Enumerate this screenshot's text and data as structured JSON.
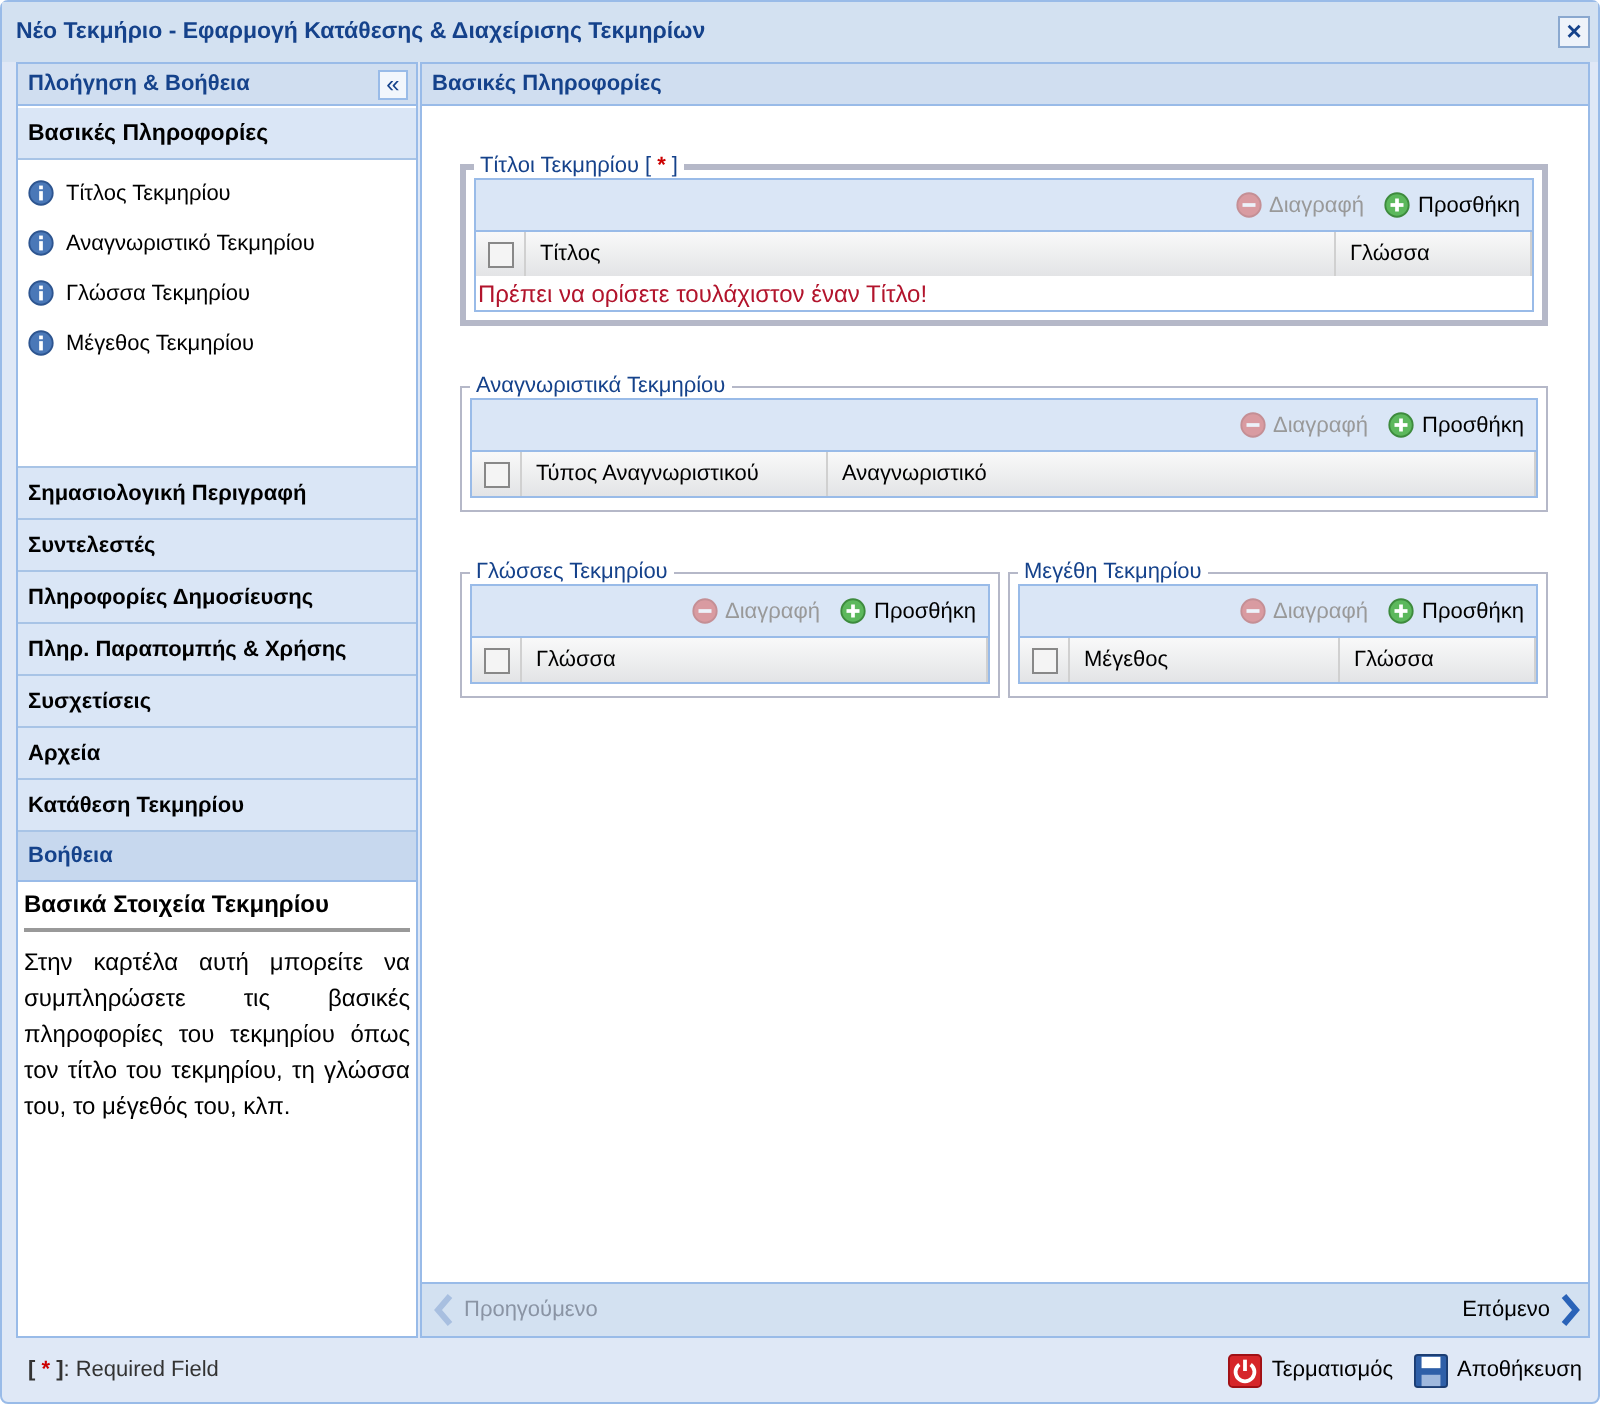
{
  "window": {
    "title": "Νέο Τεκμήριο - Εφαρμογή Κατάθεσης & Διαχείρισης Τεκμηρίων",
    "close": "×"
  },
  "sidebar": {
    "title": "Πλοήγηση & Βοήθεια",
    "collapse": "«",
    "sections": [
      {
        "label": "Βασικές Πληροφορίες",
        "expanded": true,
        "items": [
          "Τίτλος Τεκμηρίου",
          "Αναγνωριστικό Τεκμηρίου",
          "Γλώσσα Τεκμηρίου",
          "Μέγεθος Τεκμηρίου"
        ]
      },
      {
        "label": "Σημασιολογική Περιγραφή",
        "expanded": false
      },
      {
        "label": "Συντελεστές",
        "expanded": false
      },
      {
        "label": "Πληροφορίες Δημοσίευσης",
        "expanded": false
      },
      {
        "label": "Πληρ. Παραπομπής & Χρήσης",
        "expanded": false
      },
      {
        "label": "Συσχετίσεις",
        "expanded": false
      },
      {
        "label": "Αρχεία",
        "expanded": false
      },
      {
        "label": "Κατάθεση Τεκμηρίου",
        "expanded": false
      }
    ],
    "help": {
      "title": "Βοήθεια",
      "heading": "Βασικά Στοιχεία Τεκμηρίου",
      "text": "Στην καρτέλα αυτή μπορείτε να συμπληρώσετε τις βασικές πληροφορίες του τεκμηρίου όπως τον τίτλο του τεκμηρίου, τη γλώσσα του, το μέγεθός του, κλπ."
    }
  },
  "main": {
    "title": "Βασικές Πληροφορίες",
    "rows": [
      [
        {
          "legend": "Τίτλοι Τεκμηρίου",
          "required": {
            "open": "[",
            "star": "*",
            "close": "]"
          },
          "delete": {
            "label": "Διαγραφή",
            "disabled": true
          },
          "add": {
            "label": "Προσθήκη",
            "disabled": false
          },
          "all_selected": false,
          "columns": [
            {
              "label": "Τίτλος",
              "wide": true
            },
            {
              "label": "Γλώσσα",
              "wide": false
            }
          ],
          "error": "Πρέπει να ορίσετε τουλάχιστον έναν Τίτλο!"
        }
      ],
      [
        {
          "legend": "Αναγνωριστικά Τεκμηρίου",
          "delete": {
            "label": "Διαγραφή",
            "disabled": true
          },
          "add": {
            "label": "Προσθήκη",
            "disabled": false
          },
          "all_selected": false,
          "columns": [
            {
              "label": "Τύπος Αναγνωριστικού",
              "wide": false
            },
            {
              "label": "Αναγνωριστικό",
              "wide": true
            }
          ]
        }
      ],
      [
        {
          "legend": "Γλώσσες Τεκμηρίου",
          "delete": {
            "label": "Διαγραφή",
            "disabled": true
          },
          "add": {
            "label": "Προσθήκη",
            "disabled": false
          },
          "all_selected": false,
          "columns": [
            {
              "label": "Γλώσσα",
              "wide": true
            }
          ]
        },
        {
          "legend": "Μεγέθη Τεκμηρίου",
          "delete": {
            "label": "Διαγραφή",
            "disabled": true
          },
          "add": {
            "label": "Προσθήκη",
            "disabled": false
          },
          "all_selected": false,
          "columns": [
            {
              "label": "Μέγεθος",
              "wide": true
            },
            {
              "label": "Γλώσσα",
              "wide": false
            }
          ]
        }
      ]
    ],
    "prev": {
      "label": "Προηγούμενο",
      "disabled": true
    },
    "next": {
      "label": "Επόμενο",
      "disabled": false
    }
  },
  "footer": {
    "note": {
      "open": "[",
      "star": "*",
      "close": "]",
      "text": ": Required Field"
    },
    "buttons": [
      {
        "kind": "power",
        "label": "Τερματισμός"
      },
      {
        "kind": "save",
        "label": "Αποθήκευση"
      }
    ]
  }
}
